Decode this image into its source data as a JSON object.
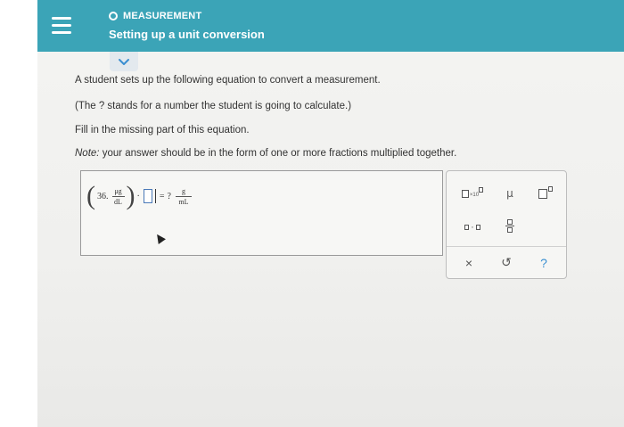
{
  "header": {
    "topic": "MEASUREMENT",
    "title": "Setting up a unit conversion",
    "color": "#3ba4b7"
  },
  "prompt": {
    "line1": "A student sets up the following equation to convert a measurement.",
    "line2": "(The ? stands for a number the student is going to calculate.)",
    "line3": "Fill in the missing part of this equation.",
    "note_label": "Note:",
    "note_text": " your answer should be in the form of one or more fractions multiplied together."
  },
  "equation": {
    "coefficient": "36.",
    "unit_numerator": "μg",
    "unit_denominator": "dL",
    "dot": "·",
    "equals": "=",
    "unknown": "?",
    "result_numerator": "g",
    "result_denominator": "mL"
  },
  "palette": {
    "x10_label": "×10",
    "mu_label": "μ",
    "times_dot": "·",
    "clear_symbol": "×",
    "undo_symbol": "↺",
    "help_symbol": "?"
  }
}
